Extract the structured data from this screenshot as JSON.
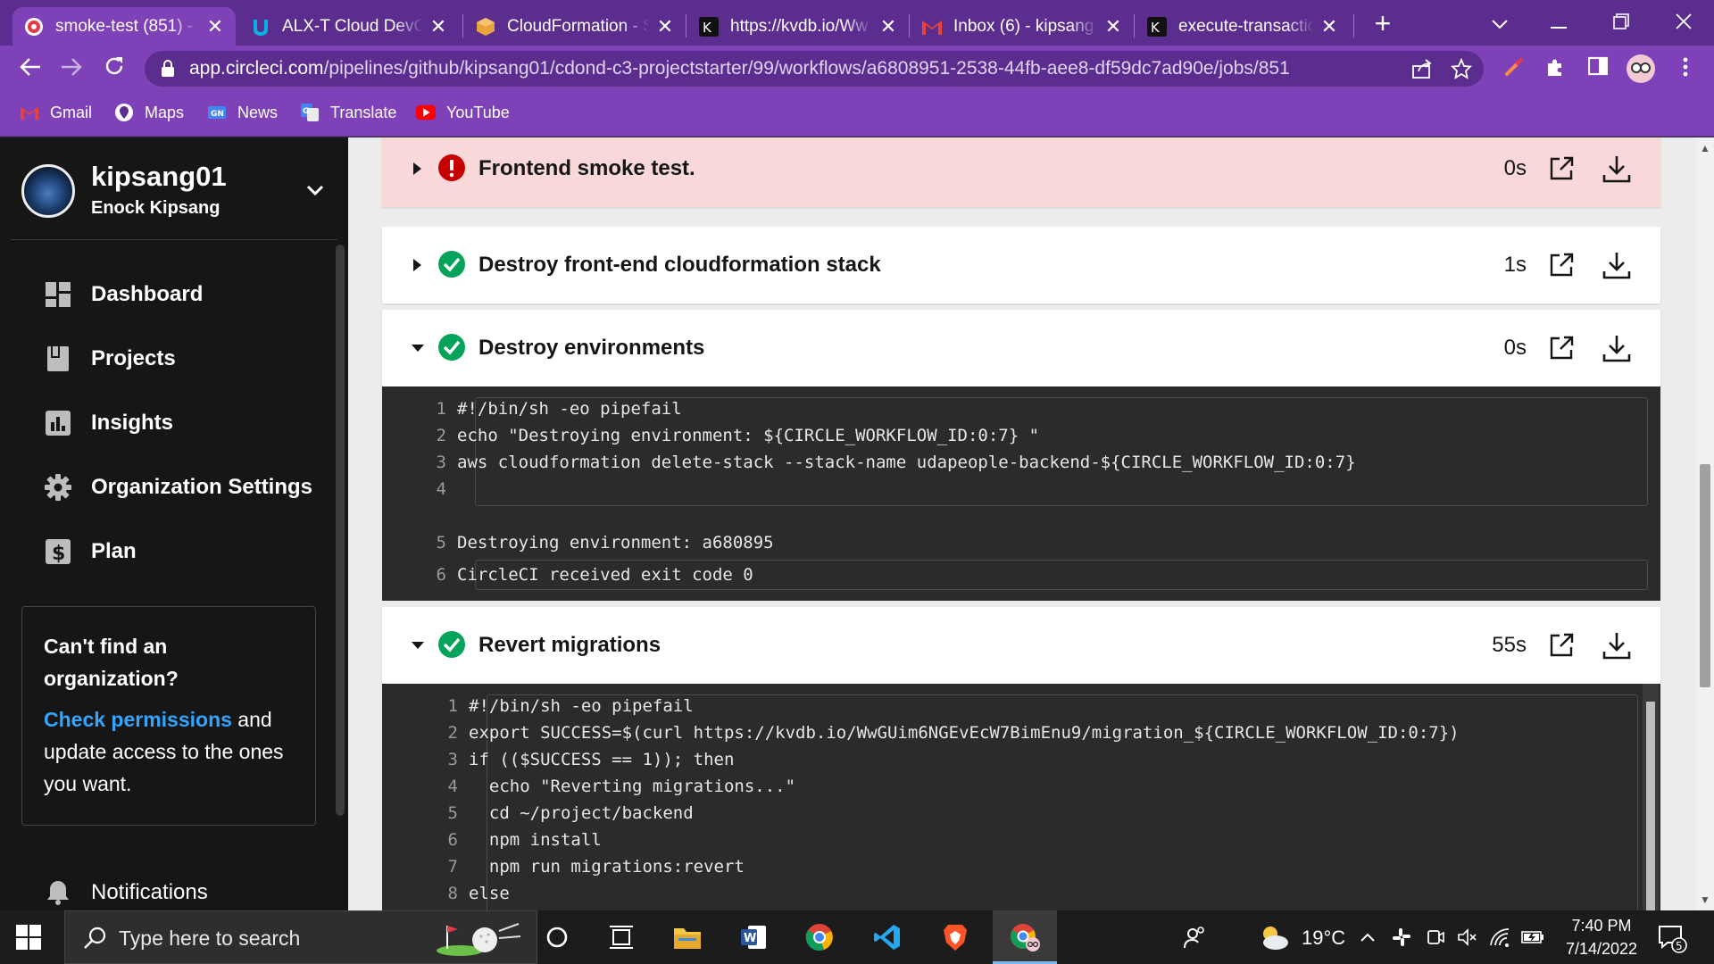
{
  "browser": {
    "tabs": [
      {
        "title": "smoke-test (851) - ",
        "icon": "circleci-icon",
        "active": true
      },
      {
        "title": "ALX-T Cloud DevOp",
        "icon": "udacity-icon",
        "active": false
      },
      {
        "title": "CloudFormation - S",
        "icon": "aws-cube-icon",
        "active": false
      },
      {
        "title": "https://kvdb.io/Ww",
        "icon": "kvdb-icon",
        "active": false
      },
      {
        "title": "Inbox (6) - kipsang",
        "icon": "gmail-icon",
        "active": false
      },
      {
        "title": "execute-transaction",
        "icon": "kvdb-icon",
        "active": false
      }
    ],
    "tab_close": "✕",
    "new_tab": "+",
    "url_host": "app.circleci.com",
    "url_path": "/pipelines/github/kipsang01/cdond-c3-projectstarter/99/workflows/a6808951-2538-44fb-aee8-df59dc7ad90e/jobs/851",
    "bookmarks": [
      {
        "label": "Gmail",
        "icon": "gmail-icon"
      },
      {
        "label": "Maps",
        "icon": "maps-icon"
      },
      {
        "label": "News",
        "icon": "news-icon"
      },
      {
        "label": "Translate",
        "icon": "translate-icon"
      },
      {
        "label": "YouTube",
        "icon": "youtube-icon"
      }
    ],
    "colors": {
      "frame": "#5b2d8e",
      "toolbar": "#7e41b8"
    }
  },
  "sidebar": {
    "username": "kipsang01",
    "fullname": "Enock Kipsang",
    "nav": [
      {
        "label": "Dashboard",
        "icon": "dashboard-icon"
      },
      {
        "label": "Projects",
        "icon": "projects-icon"
      },
      {
        "label": "Insights",
        "icon": "insights-icon"
      },
      {
        "label": "Organization Settings",
        "icon": "gear-icon"
      },
      {
        "label": "Plan",
        "icon": "dollar-icon"
      }
    ],
    "org_box": {
      "question": "Can't find an organization?",
      "link": "Check permissions",
      "rest": " and update access to the ones you want."
    },
    "notifications": "Notifications"
  },
  "steps": [
    {
      "name": "Frontend smoke test.",
      "duration": "0s",
      "status": "failed",
      "expanded": false
    },
    {
      "name": "Destroy front-end cloudformation stack",
      "duration": "1s",
      "status": "success",
      "expanded": false
    },
    {
      "name": "Destroy environments",
      "duration": "0s",
      "status": "success",
      "expanded": true
    },
    {
      "name": "Revert migrations",
      "duration": "55s",
      "status": "success",
      "expanded": true
    }
  ],
  "console_destroy": {
    "script": [
      {
        "n": "1",
        "t": "#!/bin/sh -eo pipefail"
      },
      {
        "n": "2",
        "t": "echo \"Destroying environment: ${CIRCLE_WORKFLOW_ID:0:7} \""
      },
      {
        "n": "3",
        "t": "aws cloudformation delete-stack --stack-name udapeople-backend-${CIRCLE_WORKFLOW_ID:0:7}"
      },
      {
        "n": "4",
        "t": ""
      }
    ],
    "output": [
      {
        "n": "5",
        "t": "Destroying environment: a680895"
      },
      {
        "n": "6",
        "t": "CircleCI received exit code 0"
      }
    ]
  },
  "console_revert": {
    "script": [
      {
        "n": "1",
        "t": "#!/bin/sh -eo pipefail"
      },
      {
        "n": "2",
        "t": "export SUCCESS=$(curl https://kvdb.io/WwGUim6NGEvEcW7BimEnu9/migration_${CIRCLE_WORKFLOW_ID:0:7})"
      },
      {
        "n": "3",
        "t": "if (($SUCCESS == 1)); then"
      },
      {
        "n": "4",
        "t": "  echo \"Reverting migrations...\""
      },
      {
        "n": "5",
        "t": "  cd ~/project/backend"
      },
      {
        "n": "6",
        "t": "  npm install"
      },
      {
        "n": "7",
        "t": "  npm run migrations:revert"
      },
      {
        "n": "8",
        "t": "else"
      }
    ]
  },
  "taskbar": {
    "search_placeholder": "Type here to search",
    "weather": "19°C",
    "time": "7:40 PM",
    "date": "7/14/2022",
    "notification_count": "5"
  },
  "status_colors": {
    "success": "#06a45a",
    "failed": "#c60000"
  }
}
